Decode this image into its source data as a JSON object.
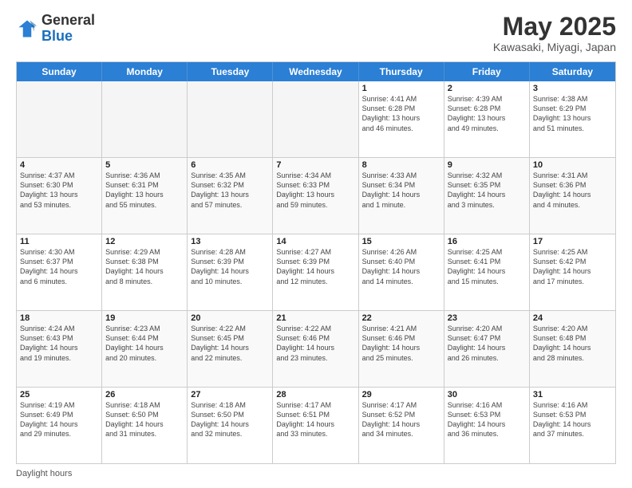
{
  "header": {
    "logo_general": "General",
    "logo_blue": "Blue",
    "month_title": "May 2025",
    "location": "Kawasaki, Miyagi, Japan"
  },
  "days_of_week": [
    "Sunday",
    "Monday",
    "Tuesday",
    "Wednesday",
    "Thursday",
    "Friday",
    "Saturday"
  ],
  "footer_note": "Daylight hours",
  "weeks": [
    [
      {
        "day": "",
        "info": ""
      },
      {
        "day": "",
        "info": ""
      },
      {
        "day": "",
        "info": ""
      },
      {
        "day": "",
        "info": ""
      },
      {
        "day": "1",
        "info": "Sunrise: 4:41 AM\nSunset: 6:28 PM\nDaylight: 13 hours\nand 46 minutes."
      },
      {
        "day": "2",
        "info": "Sunrise: 4:39 AM\nSunset: 6:28 PM\nDaylight: 13 hours\nand 49 minutes."
      },
      {
        "day": "3",
        "info": "Sunrise: 4:38 AM\nSunset: 6:29 PM\nDaylight: 13 hours\nand 51 minutes."
      }
    ],
    [
      {
        "day": "4",
        "info": "Sunrise: 4:37 AM\nSunset: 6:30 PM\nDaylight: 13 hours\nand 53 minutes."
      },
      {
        "day": "5",
        "info": "Sunrise: 4:36 AM\nSunset: 6:31 PM\nDaylight: 13 hours\nand 55 minutes."
      },
      {
        "day": "6",
        "info": "Sunrise: 4:35 AM\nSunset: 6:32 PM\nDaylight: 13 hours\nand 57 minutes."
      },
      {
        "day": "7",
        "info": "Sunrise: 4:34 AM\nSunset: 6:33 PM\nDaylight: 13 hours\nand 59 minutes."
      },
      {
        "day": "8",
        "info": "Sunrise: 4:33 AM\nSunset: 6:34 PM\nDaylight: 14 hours\nand 1 minute."
      },
      {
        "day": "9",
        "info": "Sunrise: 4:32 AM\nSunset: 6:35 PM\nDaylight: 14 hours\nand 3 minutes."
      },
      {
        "day": "10",
        "info": "Sunrise: 4:31 AM\nSunset: 6:36 PM\nDaylight: 14 hours\nand 4 minutes."
      }
    ],
    [
      {
        "day": "11",
        "info": "Sunrise: 4:30 AM\nSunset: 6:37 PM\nDaylight: 14 hours\nand 6 minutes."
      },
      {
        "day": "12",
        "info": "Sunrise: 4:29 AM\nSunset: 6:38 PM\nDaylight: 14 hours\nand 8 minutes."
      },
      {
        "day": "13",
        "info": "Sunrise: 4:28 AM\nSunset: 6:39 PM\nDaylight: 14 hours\nand 10 minutes."
      },
      {
        "day": "14",
        "info": "Sunrise: 4:27 AM\nSunset: 6:39 PM\nDaylight: 14 hours\nand 12 minutes."
      },
      {
        "day": "15",
        "info": "Sunrise: 4:26 AM\nSunset: 6:40 PM\nDaylight: 14 hours\nand 14 minutes."
      },
      {
        "day": "16",
        "info": "Sunrise: 4:25 AM\nSunset: 6:41 PM\nDaylight: 14 hours\nand 15 minutes."
      },
      {
        "day": "17",
        "info": "Sunrise: 4:25 AM\nSunset: 6:42 PM\nDaylight: 14 hours\nand 17 minutes."
      }
    ],
    [
      {
        "day": "18",
        "info": "Sunrise: 4:24 AM\nSunset: 6:43 PM\nDaylight: 14 hours\nand 19 minutes."
      },
      {
        "day": "19",
        "info": "Sunrise: 4:23 AM\nSunset: 6:44 PM\nDaylight: 14 hours\nand 20 minutes."
      },
      {
        "day": "20",
        "info": "Sunrise: 4:22 AM\nSunset: 6:45 PM\nDaylight: 14 hours\nand 22 minutes."
      },
      {
        "day": "21",
        "info": "Sunrise: 4:22 AM\nSunset: 6:46 PM\nDaylight: 14 hours\nand 23 minutes."
      },
      {
        "day": "22",
        "info": "Sunrise: 4:21 AM\nSunset: 6:46 PM\nDaylight: 14 hours\nand 25 minutes."
      },
      {
        "day": "23",
        "info": "Sunrise: 4:20 AM\nSunset: 6:47 PM\nDaylight: 14 hours\nand 26 minutes."
      },
      {
        "day": "24",
        "info": "Sunrise: 4:20 AM\nSunset: 6:48 PM\nDaylight: 14 hours\nand 28 minutes."
      }
    ],
    [
      {
        "day": "25",
        "info": "Sunrise: 4:19 AM\nSunset: 6:49 PM\nDaylight: 14 hours\nand 29 minutes."
      },
      {
        "day": "26",
        "info": "Sunrise: 4:18 AM\nSunset: 6:50 PM\nDaylight: 14 hours\nand 31 minutes."
      },
      {
        "day": "27",
        "info": "Sunrise: 4:18 AM\nSunset: 6:50 PM\nDaylight: 14 hours\nand 32 minutes."
      },
      {
        "day": "28",
        "info": "Sunrise: 4:17 AM\nSunset: 6:51 PM\nDaylight: 14 hours\nand 33 minutes."
      },
      {
        "day": "29",
        "info": "Sunrise: 4:17 AM\nSunset: 6:52 PM\nDaylight: 14 hours\nand 34 minutes."
      },
      {
        "day": "30",
        "info": "Sunrise: 4:16 AM\nSunset: 6:53 PM\nDaylight: 14 hours\nand 36 minutes."
      },
      {
        "day": "31",
        "info": "Sunrise: 4:16 AM\nSunset: 6:53 PM\nDaylight: 14 hours\nand 37 minutes."
      }
    ]
  ]
}
